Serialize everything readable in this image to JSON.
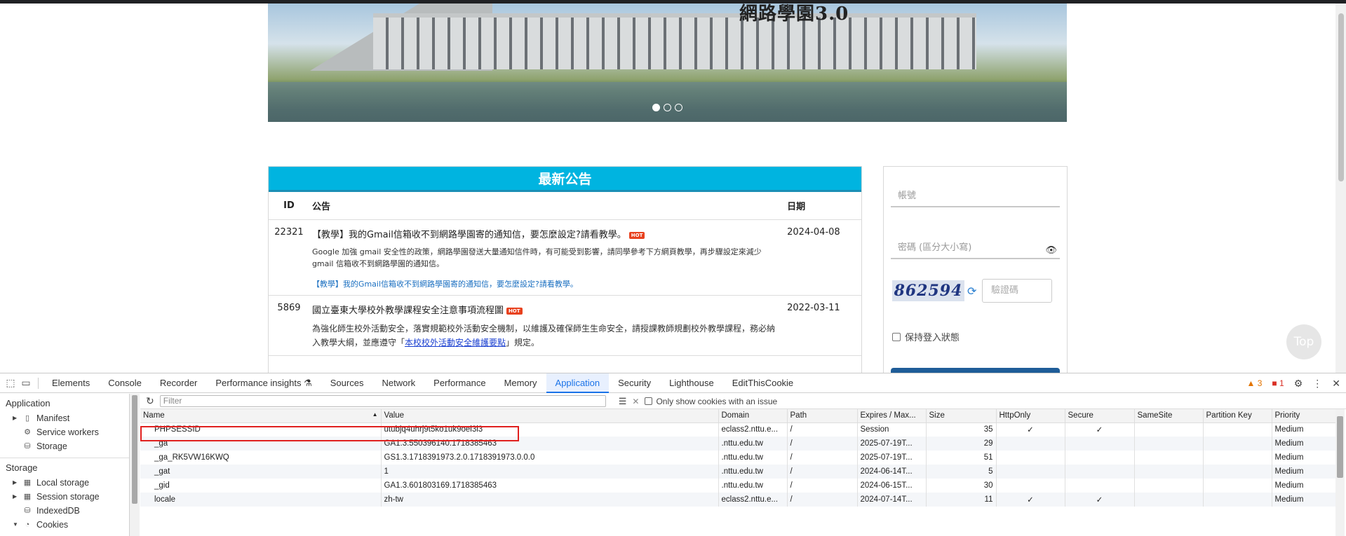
{
  "banner": {
    "title": "網路學園3.0",
    "dots": 3
  },
  "news": {
    "heading": "最新公告",
    "columns": {
      "id": "ID",
      "title": "公告",
      "date": "日期"
    },
    "hot_label": "HOT",
    "rows": [
      {
        "id": "22321",
        "title": "【教學】我的Gmail信箱收不到網路學園寄的通知信，要怎麼設定?請看教學。",
        "desc": "Google 加強 gmail 安全性的政策，網路學園發送大量通知信件時，有可能受到影響，請同學參考下方網頁教學，再步驟設定來減少 gmail 信箱收不到網路學園的通知信。",
        "link": "【教學】我的Gmail信箱收不到網路學園寄的通知信，要怎麼設定?請看教學。",
        "date": "2024-04-08"
      },
      {
        "id": "5869",
        "title": "國立臺東大學校外教學課程安全注意事項流程圖",
        "desc_a": "為強化師生校外活動安全，落實規範校外活動安全機制，以維護及確保師生生命安全，請授課教師規劃校外教學課程，務必納入教學大綱，並應遵守「",
        "desc_link": "本校校外活動安全維護要點",
        "desc_b": "」規定。",
        "date": "2022-03-11"
      }
    ]
  },
  "login": {
    "account_placeholder": "帳號",
    "password_placeholder": "密碼 (區分大小寫)",
    "captcha_text": "862594",
    "captcha_placeholder": "驗證碼",
    "keep_login": "保持登入狀態"
  },
  "top_button": "Top",
  "devtools": {
    "tabs": [
      "Elements",
      "Console",
      "Recorder",
      "Performance insights ⚗",
      "Sources",
      "Network",
      "Performance",
      "Memory",
      "Application",
      "Security",
      "Lighthouse",
      "EditThisCookie"
    ],
    "active_tab": "Application",
    "warnings": "3",
    "errors": "1",
    "sidebar": {
      "application_header": "Application",
      "application_items": [
        "Manifest",
        "Service workers",
        "Storage"
      ],
      "storage_header": "Storage",
      "storage_items": [
        "Local storage",
        "Session storage",
        "IndexedDB",
        "Cookies"
      ]
    },
    "filter_placeholder": "Filter",
    "only_issues_label": "Only show cookies with an issue",
    "columns": [
      "Name",
      "Value",
      "Domain",
      "Path",
      "Expires / Max...",
      "Size",
      "HttpOnly",
      "Secure",
      "SameSite",
      "Partition Key",
      "Priority"
    ],
    "cookies": [
      [
        "PHPSESSID",
        "utubjq4uhrj9t5ko1uk9oei3l3",
        "eclass2.nttu.e...",
        "/",
        "Session",
        "35",
        "✓",
        "✓",
        "",
        "",
        "Medium"
      ],
      [
        "_ga",
        "GA1.3.550396140.1718385463",
        ".nttu.edu.tw",
        "/",
        "2025-07-19T...",
        "29",
        "",
        "",
        "",
        "",
        "Medium"
      ],
      [
        "_ga_RK5VW16KWQ",
        "GS1.3.1718391973.2.0.1718391973.0.0.0",
        ".nttu.edu.tw",
        "/",
        "2025-07-19T...",
        "51",
        "",
        "",
        "",
        "",
        "Medium"
      ],
      [
        "_gat",
        "1",
        ".nttu.edu.tw",
        "/",
        "2024-06-14T...",
        "5",
        "",
        "",
        "",
        "",
        "Medium"
      ],
      [
        "_gid",
        "GA1.3.601803169.1718385463",
        ".nttu.edu.tw",
        "/",
        "2024-06-15T...",
        "30",
        "",
        "",
        "",
        "",
        "Medium"
      ],
      [
        "locale",
        "zh-tw",
        "eclass2.nttu.e...",
        "/",
        "2024-07-14T...",
        "11",
        "✓",
        "✓",
        "",
        "",
        "Medium"
      ]
    ]
  }
}
